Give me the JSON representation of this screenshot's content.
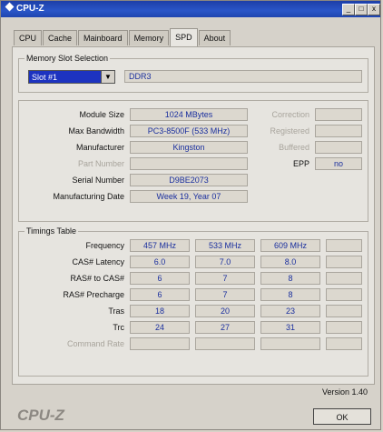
{
  "window": {
    "title": "CPU-Z",
    "minimize": "_",
    "maximize": "□",
    "close": "x"
  },
  "tabs": [
    {
      "label": "CPU"
    },
    {
      "label": "Cache"
    },
    {
      "label": "Mainboard"
    },
    {
      "label": "Memory"
    },
    {
      "label": "SPD",
      "active": true
    },
    {
      "label": "About"
    }
  ],
  "slot_selection": {
    "title": "Memory Slot Selection",
    "selected": "Slot #1",
    "type": "DDR3"
  },
  "module": {
    "size_label": "Module Size",
    "size": "1024 MBytes",
    "bandwidth_label": "Max Bandwidth",
    "bandwidth": "PC3-8500F (533 MHz)",
    "manufacturer_label": "Manufacturer",
    "manufacturer": "Kingston",
    "part_label": "Part Number",
    "part": "",
    "serial_label": "Serial Number",
    "serial": "D9BE2073",
    "date_label": "Manufacturing Date",
    "date": "Week 19, Year 07",
    "correction_label": "Correction",
    "correction": "",
    "registered_label": "Registered",
    "registered": "",
    "buffered_label": "Buffered",
    "buffered": "",
    "epp_label": "EPP",
    "epp": "no"
  },
  "timings": {
    "title": "Timings Table",
    "rows": [
      {
        "label": "Frequency",
        "values": [
          "457 MHz",
          "533 MHz",
          "609 MHz",
          ""
        ]
      },
      {
        "label": "CAS# Latency",
        "values": [
          "6.0",
          "7.0",
          "8.0",
          ""
        ]
      },
      {
        "label": "RAS# to CAS#",
        "values": [
          "6",
          "7",
          "8",
          ""
        ]
      },
      {
        "label": "RAS# Precharge",
        "values": [
          "6",
          "7",
          "8",
          ""
        ]
      },
      {
        "label": "Tras",
        "values": [
          "18",
          "20",
          "23",
          ""
        ]
      },
      {
        "label": "Trc",
        "values": [
          "24",
          "27",
          "31",
          ""
        ]
      },
      {
        "label": "Command Rate",
        "values": [
          "",
          "",
          "",
          ""
        ]
      }
    ]
  },
  "footer": {
    "version": "Version 1.40",
    "brand": "CPU-Z",
    "ok": "OK"
  }
}
